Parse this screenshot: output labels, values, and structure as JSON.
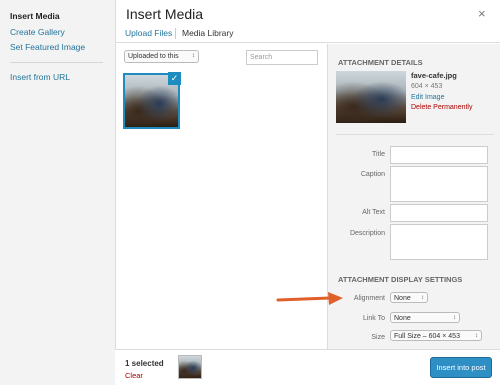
{
  "left_menu": {
    "items": [
      {
        "label": "Insert Media",
        "active": true
      },
      {
        "label": "Create Gallery",
        "active": false
      },
      {
        "label": "Set Featured Image",
        "active": false
      },
      {
        "label": "Insert from URL",
        "active": false
      }
    ]
  },
  "header": {
    "title": "Insert Media",
    "close_icon": "×"
  },
  "tabs": {
    "upload_files": "Upload Files",
    "media_library": "Media Library"
  },
  "toolbar": {
    "filter_value": "Uploaded to this",
    "search_placeholder": "Search"
  },
  "attachment_details": {
    "section_title": "ATTACHMENT DETAILS",
    "file_name": "fave-cafe.jpg",
    "dimensions": "604 × 453",
    "edit_label": "Edit Image",
    "delete_label": "Delete Permanently",
    "fields": {
      "title": "Title",
      "caption": "Caption",
      "alt_text": "Alt Text",
      "description": "Description"
    }
  },
  "display_settings": {
    "section_title": "ATTACHMENT DISPLAY SETTINGS",
    "alignment_label": "Alignment",
    "alignment_value": "None",
    "link_to_label": "Link To",
    "link_to_value": "None",
    "size_label": "Size",
    "size_value": "Full Size – 604 × 453"
  },
  "footer": {
    "selected_count": "1 selected",
    "clear_label": "Clear",
    "insert_button": "Insert into post"
  },
  "colors": {
    "accent": "#1e8cbe",
    "link": "#21759b",
    "danger": "#aa0000",
    "annotation_arrow": "#e0602a"
  },
  "icons": {
    "check": "✓",
    "select_arrows": "↕"
  }
}
